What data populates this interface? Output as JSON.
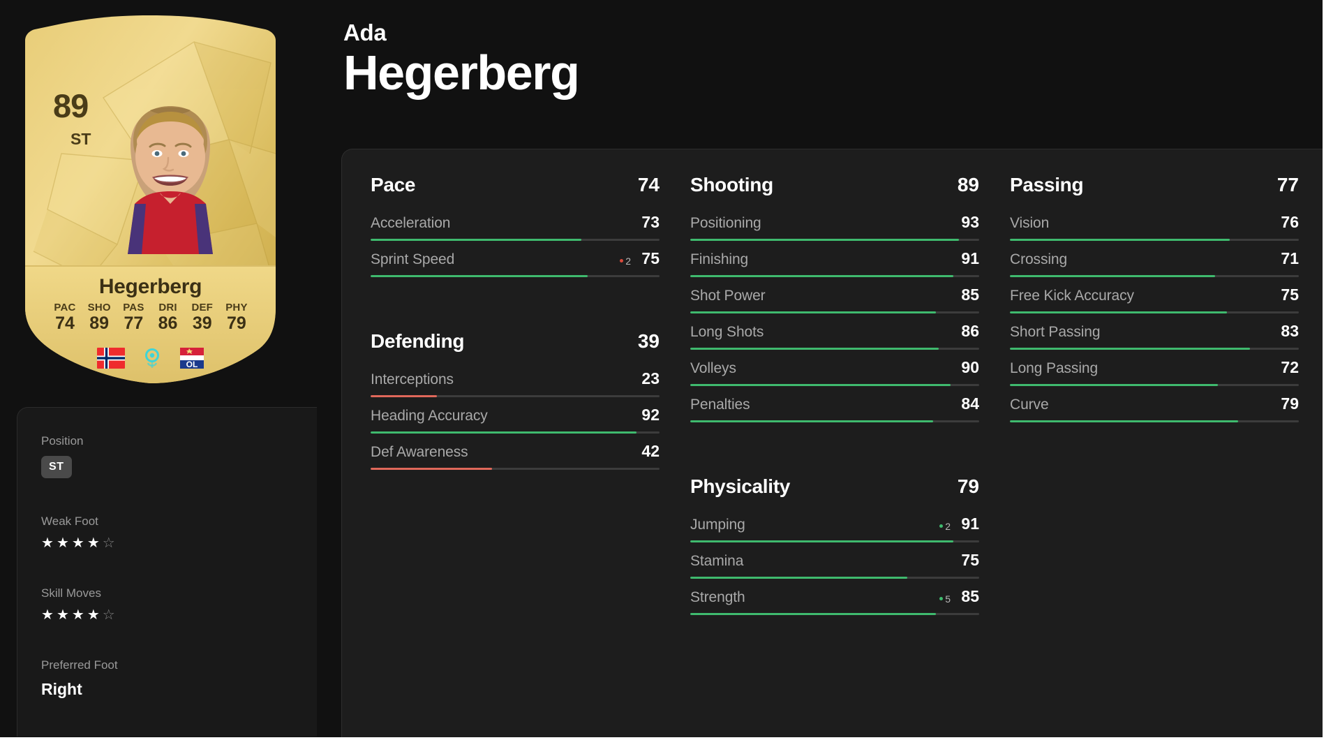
{
  "player": {
    "first_name": "Ada",
    "last_name": "Hegerberg"
  },
  "card": {
    "rating": "89",
    "position": "ST",
    "name": "Hegerberg",
    "face_alt": "player-face",
    "stats": [
      {
        "label": "PAC",
        "value": "74"
      },
      {
        "label": "SHO",
        "value": "89"
      },
      {
        "label": "PAS",
        "value": "77"
      },
      {
        "label": "DRI",
        "value": "86"
      },
      {
        "label": "DEF",
        "value": "39"
      },
      {
        "label": "PHY",
        "value": "79"
      }
    ],
    "badges": {
      "nation": "norway-flag",
      "league": "league-logo",
      "club": "ol-club-badge"
    },
    "colors": {
      "gold_light": "#f3dd8e",
      "gold_mid": "#e3c468",
      "gold_dark": "#c8a544",
      "text_dark": "#3b3015"
    }
  },
  "sidebar": {
    "position_label": "Position",
    "position_value": "ST",
    "weak_foot_label": "Weak Foot",
    "weak_foot_rating": 4,
    "weak_foot_max": 5,
    "skill_moves_label": "Skill Moves",
    "skill_moves_rating": 4,
    "skill_moves_max": 5,
    "preferred_foot_label": "Preferred Foot",
    "preferred_foot_value": "Right",
    "star_filled_glyph": "★",
    "star_empty_glyph": "☆"
  },
  "colors": {
    "page_bg": "#111111",
    "panel_bg": "#1d1d1d",
    "bar_good": "#3fba6e",
    "bar_bad": "#e0685a",
    "bar_track": "#3c3c3c",
    "text_primary": "#ffffff",
    "text_muted": "#a9a9a9"
  },
  "stat_groups": [
    {
      "name": "Pace",
      "total": "74",
      "column": 0,
      "stats": [
        {
          "name": "Acceleration",
          "value": 73,
          "delta": null
        },
        {
          "name": "Sprint Speed",
          "value": 75,
          "delta": {
            "dir": "down",
            "amount": "2"
          }
        }
      ]
    },
    {
      "name": "Shooting",
      "total": "89",
      "column": 1,
      "stats": [
        {
          "name": "Positioning",
          "value": 93,
          "delta": null
        },
        {
          "name": "Finishing",
          "value": 91,
          "delta": null
        },
        {
          "name": "Shot Power",
          "value": 85,
          "delta": null
        },
        {
          "name": "Long Shots",
          "value": 86,
          "delta": null
        },
        {
          "name": "Volleys",
          "value": 90,
          "delta": null
        },
        {
          "name": "Penalties",
          "value": 84,
          "delta": null
        }
      ]
    },
    {
      "name": "Passing",
      "total": "77",
      "column": 2,
      "stats": [
        {
          "name": "Vision",
          "value": 76,
          "delta": null
        },
        {
          "name": "Crossing",
          "value": 71,
          "delta": null
        },
        {
          "name": "Free Kick Accuracy",
          "value": 75,
          "delta": null
        },
        {
          "name": "Short Passing",
          "value": 83,
          "delta": null
        },
        {
          "name": "Long Passing",
          "value": 72,
          "delta": null
        },
        {
          "name": "Curve",
          "value": 79,
          "delta": null
        }
      ]
    },
    {
      "name": "Defending",
      "total": "39",
      "column": 0,
      "stats": [
        {
          "name": "Interceptions",
          "value": 23,
          "delta": null
        },
        {
          "name": "Heading Accuracy",
          "value": 92,
          "delta": null
        },
        {
          "name": "Def Awareness",
          "value": 42,
          "delta": null
        }
      ]
    },
    {
      "name": "Physicality",
      "total": "79",
      "column": 1,
      "stats": [
        {
          "name": "Jumping",
          "value": 91,
          "delta": {
            "dir": "up",
            "amount": "2"
          }
        },
        {
          "name": "Stamina",
          "value": 75,
          "delta": null
        },
        {
          "name": "Strength",
          "value": 85,
          "delta": {
            "dir": "up",
            "amount": "5"
          }
        }
      ]
    }
  ]
}
